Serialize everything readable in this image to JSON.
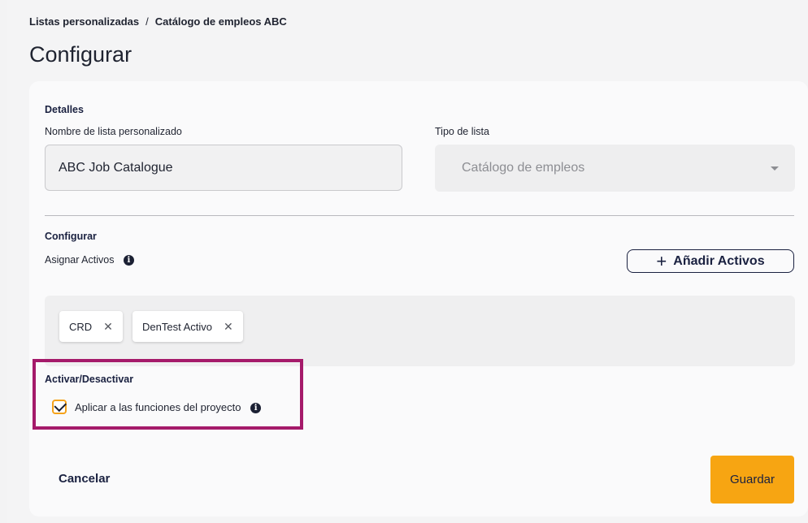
{
  "breadcrumb": {
    "parent": "Listas personalizadas",
    "separator": "/",
    "current": "Catálogo de empleos ABC"
  },
  "page_title": "Configurar",
  "details": {
    "section_title": "Detalles",
    "name_label": "Nombre de lista personalizado",
    "name_value": "ABC Job Catalogue",
    "type_label": "Tipo de lista",
    "type_value": "Catálogo de empleos"
  },
  "configure": {
    "section_title": "Configurar",
    "assign_label": "Asignar Activos",
    "add_button_label": "Añadir Activos",
    "chips": [
      {
        "label": "CRD"
      },
      {
        "label": "DenTest Activo"
      }
    ]
  },
  "toggle": {
    "section_title": "Activar/Desactivar",
    "checkbox_label": "Aplicar a las funciones del proyecto",
    "checked": true
  },
  "footer": {
    "cancel_label": "Cancelar",
    "save_label": "Guardar"
  },
  "colors": {
    "accent": "#f7a512",
    "highlight": "#a51a6a",
    "navy": "#1a2140"
  }
}
